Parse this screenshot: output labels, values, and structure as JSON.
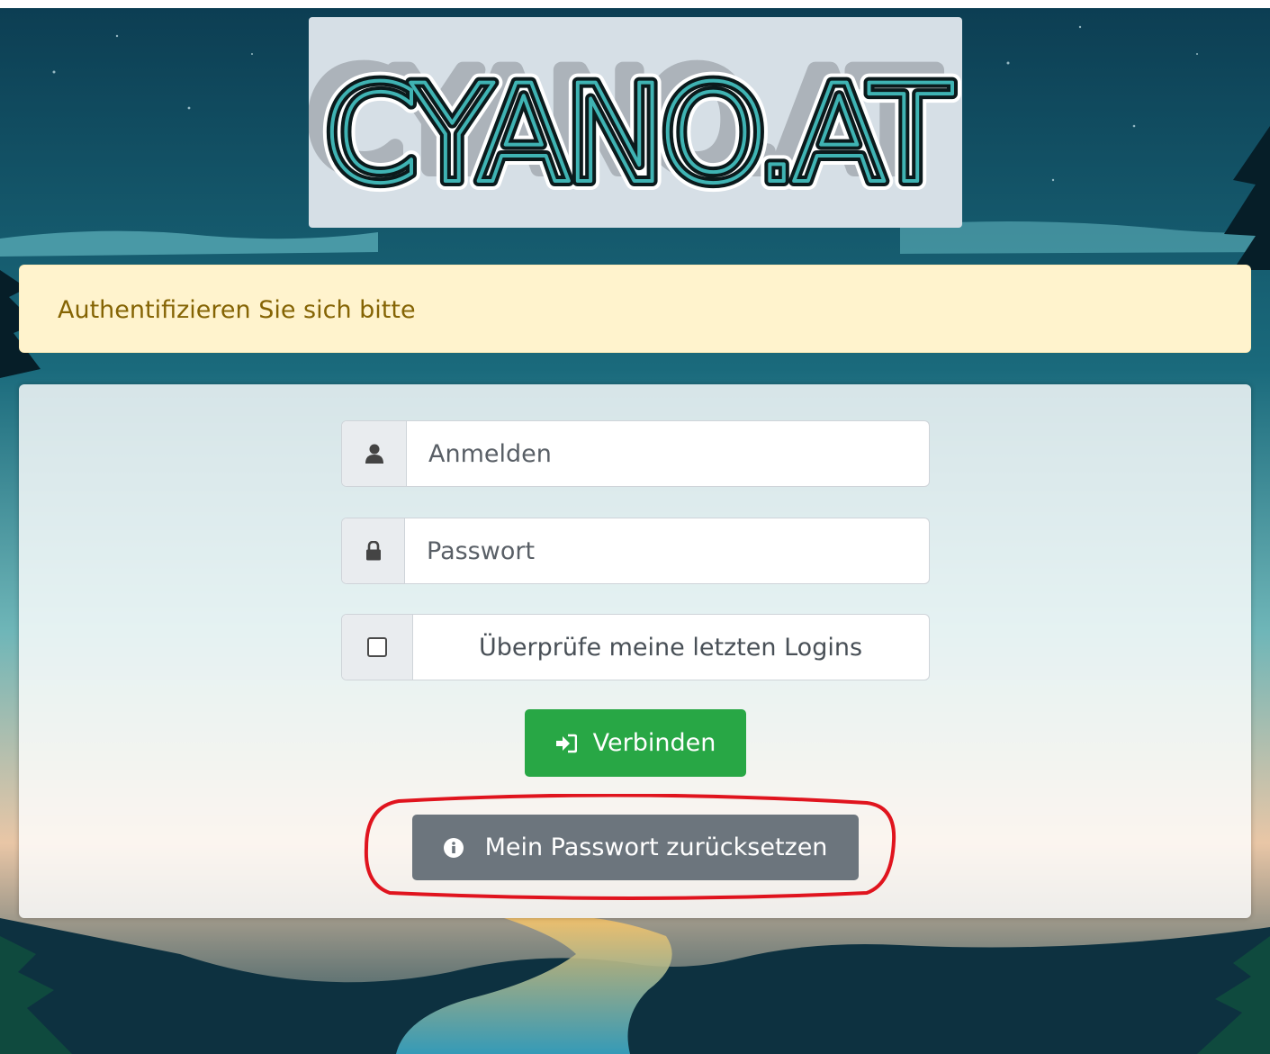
{
  "logo": {
    "text": "CYANO.AT"
  },
  "alert": {
    "message": "Authentifizieren Sie sich bitte"
  },
  "login_form": {
    "username": {
      "placeholder": "Anmelden",
      "icon": "user-icon"
    },
    "password": {
      "placeholder": "Passwort",
      "icon": "lock-icon"
    },
    "remember": {
      "label": "Überprüfe meine letzten Logins",
      "checked": false
    },
    "submit": {
      "label": "Verbinden",
      "icon": "sign-in-icon",
      "color": "#28a745"
    },
    "reset": {
      "label": "Mein Passwort zurücksetzen",
      "icon": "info-circle-icon",
      "color": "#6c757d"
    }
  },
  "annotation": {
    "color": "#e0141e"
  },
  "colors": {
    "alert_bg": "#fff3cd",
    "alert_text": "#856404",
    "logo_box": "#d6dfe6"
  }
}
